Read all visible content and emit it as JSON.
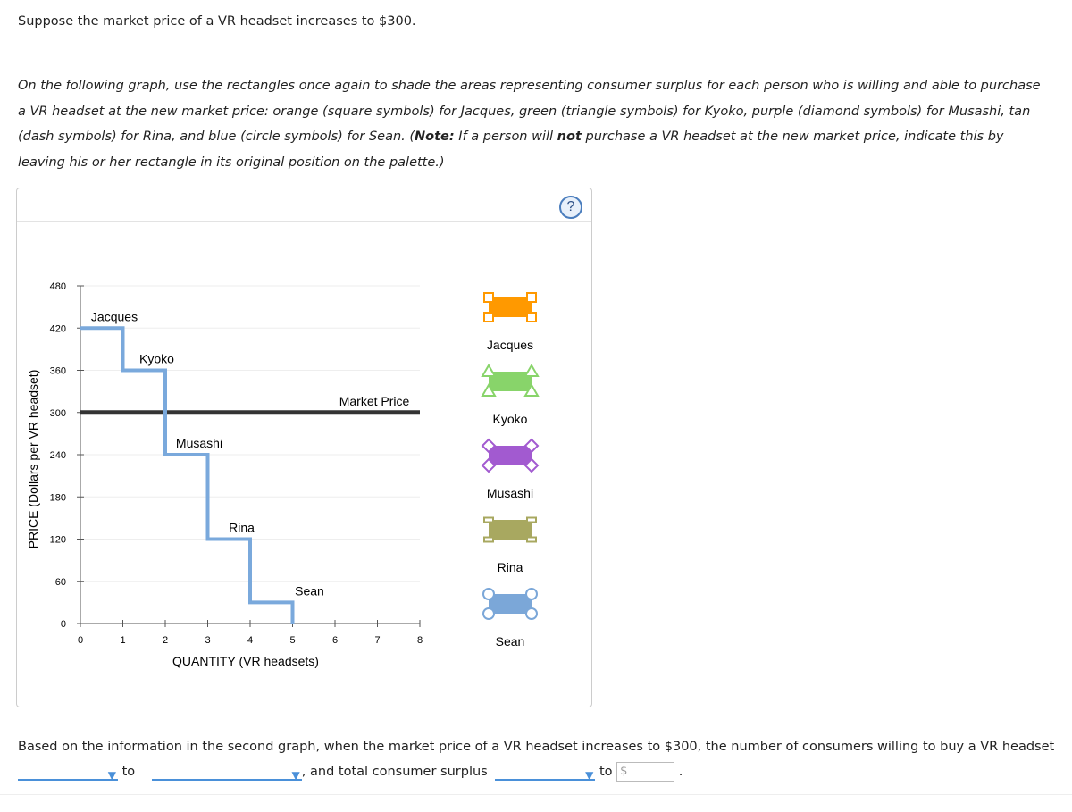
{
  "intro": "Suppose the market price of a VR headset increases to $300.",
  "instructions": {
    "part1": "On the following graph, use the rectangles once again to shade the areas representing consumer surplus for each person who is willing and able to purchase a VR headset at the new market price: orange (square symbols) for Jacques, green (triangle symbols) for Kyoko, purple (diamond symbols) for Musashi, tan (dash symbols) for Rina, and blue (circle symbols) for Sean. (",
    "note_label": "Note:",
    "part2": " If a person will ",
    "not": "not",
    "part3": " purchase a VR headset at the new market price, indicate this by leaving his or her rectangle in its original position on the palette.)"
  },
  "help_label": "?",
  "chart_data": {
    "type": "line",
    "xlabel": "QUANTITY (VR headsets)",
    "ylabel": "PRICE (Dollars per VR headset)",
    "xlim": [
      0,
      8
    ],
    "ylim": [
      0,
      480
    ],
    "x_ticks": [
      "0",
      "1",
      "2",
      "3",
      "4",
      "5",
      "6",
      "7",
      "8"
    ],
    "y_ticks": [
      "0",
      "60",
      "120",
      "180",
      "240",
      "300",
      "360",
      "420",
      "480"
    ],
    "demand_steps": [
      {
        "name": "Jacques",
        "from": 0,
        "to": 1,
        "price": 420
      },
      {
        "name": "Kyoko",
        "from": 1,
        "to": 2,
        "price": 360
      },
      {
        "name": "Musashi",
        "from": 2,
        "to": 3,
        "price": 240
      },
      {
        "name": "Rina",
        "from": 3,
        "to": 4,
        "price": 120
      },
      {
        "name": "Sean",
        "from": 4,
        "to": 5,
        "price": 30
      }
    ],
    "market_price": {
      "label": "Market Price",
      "value": 300
    },
    "demand_color": "#7aa9dc",
    "market_color": "#333333"
  },
  "palette": [
    {
      "name": "Jacques",
      "color": "#ff9900",
      "symbol": "square"
    },
    {
      "name": "Kyoko",
      "color": "#88d46a",
      "symbol": "triangle"
    },
    {
      "name": "Musashi",
      "color": "#a25ad0",
      "symbol": "diamond"
    },
    {
      "name": "Rina",
      "color": "#a8a860",
      "symbol": "dash"
    },
    {
      "name": "Sean",
      "color": "#7ba7d8",
      "symbol": "circle"
    }
  ],
  "question": {
    "t1": "Based on the information in the second graph, when the market price of a VR headset increases to $300, the number of consumers willing to buy a VR headset",
    "t2": "to",
    "t3": ", and total consumer surplus",
    "t4": "to",
    "dollar": "$",
    "end": "."
  }
}
